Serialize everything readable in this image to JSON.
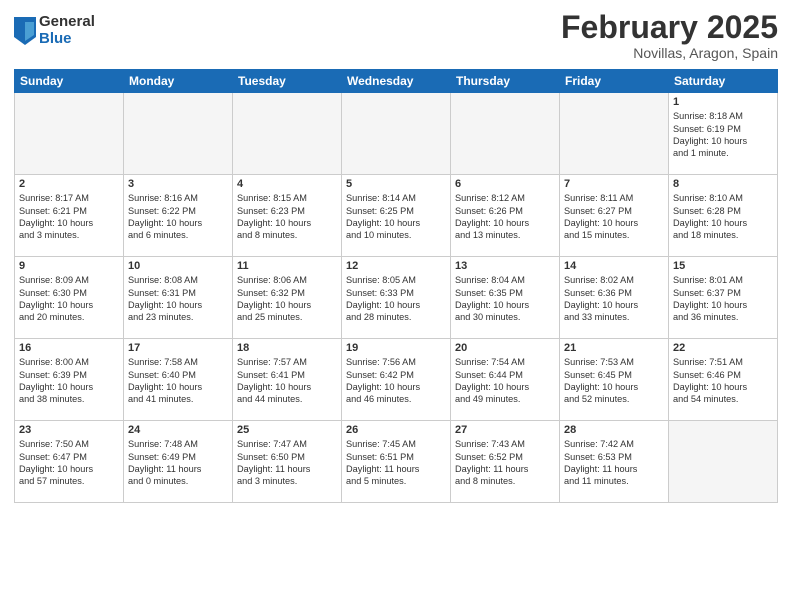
{
  "header": {
    "logo": {
      "general": "General",
      "blue": "Blue"
    },
    "title": "February 2025",
    "location": "Novillas, Aragon, Spain"
  },
  "weekdays": [
    "Sunday",
    "Monday",
    "Tuesday",
    "Wednesday",
    "Thursday",
    "Friday",
    "Saturday"
  ],
  "weeks": [
    [
      {
        "day": "",
        "info": ""
      },
      {
        "day": "",
        "info": ""
      },
      {
        "day": "",
        "info": ""
      },
      {
        "day": "",
        "info": ""
      },
      {
        "day": "",
        "info": ""
      },
      {
        "day": "",
        "info": ""
      },
      {
        "day": "1",
        "info": "Sunrise: 8:18 AM\nSunset: 6:19 PM\nDaylight: 10 hours\nand 1 minute."
      }
    ],
    [
      {
        "day": "2",
        "info": "Sunrise: 8:17 AM\nSunset: 6:21 PM\nDaylight: 10 hours\nand 3 minutes."
      },
      {
        "day": "3",
        "info": "Sunrise: 8:16 AM\nSunset: 6:22 PM\nDaylight: 10 hours\nand 6 minutes."
      },
      {
        "day": "4",
        "info": "Sunrise: 8:15 AM\nSunset: 6:23 PM\nDaylight: 10 hours\nand 8 minutes."
      },
      {
        "day": "5",
        "info": "Sunrise: 8:14 AM\nSunset: 6:25 PM\nDaylight: 10 hours\nand 10 minutes."
      },
      {
        "day": "6",
        "info": "Sunrise: 8:12 AM\nSunset: 6:26 PM\nDaylight: 10 hours\nand 13 minutes."
      },
      {
        "day": "7",
        "info": "Sunrise: 8:11 AM\nSunset: 6:27 PM\nDaylight: 10 hours\nand 15 minutes."
      },
      {
        "day": "8",
        "info": "Sunrise: 8:10 AM\nSunset: 6:28 PM\nDaylight: 10 hours\nand 18 minutes."
      }
    ],
    [
      {
        "day": "9",
        "info": "Sunrise: 8:09 AM\nSunset: 6:30 PM\nDaylight: 10 hours\nand 20 minutes."
      },
      {
        "day": "10",
        "info": "Sunrise: 8:08 AM\nSunset: 6:31 PM\nDaylight: 10 hours\nand 23 minutes."
      },
      {
        "day": "11",
        "info": "Sunrise: 8:06 AM\nSunset: 6:32 PM\nDaylight: 10 hours\nand 25 minutes."
      },
      {
        "day": "12",
        "info": "Sunrise: 8:05 AM\nSunset: 6:33 PM\nDaylight: 10 hours\nand 28 minutes."
      },
      {
        "day": "13",
        "info": "Sunrise: 8:04 AM\nSunset: 6:35 PM\nDaylight: 10 hours\nand 30 minutes."
      },
      {
        "day": "14",
        "info": "Sunrise: 8:02 AM\nSunset: 6:36 PM\nDaylight: 10 hours\nand 33 minutes."
      },
      {
        "day": "15",
        "info": "Sunrise: 8:01 AM\nSunset: 6:37 PM\nDaylight: 10 hours\nand 36 minutes."
      }
    ],
    [
      {
        "day": "16",
        "info": "Sunrise: 8:00 AM\nSunset: 6:39 PM\nDaylight: 10 hours\nand 38 minutes."
      },
      {
        "day": "17",
        "info": "Sunrise: 7:58 AM\nSunset: 6:40 PM\nDaylight: 10 hours\nand 41 minutes."
      },
      {
        "day": "18",
        "info": "Sunrise: 7:57 AM\nSunset: 6:41 PM\nDaylight: 10 hours\nand 44 minutes."
      },
      {
        "day": "19",
        "info": "Sunrise: 7:56 AM\nSunset: 6:42 PM\nDaylight: 10 hours\nand 46 minutes."
      },
      {
        "day": "20",
        "info": "Sunrise: 7:54 AM\nSunset: 6:44 PM\nDaylight: 10 hours\nand 49 minutes."
      },
      {
        "day": "21",
        "info": "Sunrise: 7:53 AM\nSunset: 6:45 PM\nDaylight: 10 hours\nand 52 minutes."
      },
      {
        "day": "22",
        "info": "Sunrise: 7:51 AM\nSunset: 6:46 PM\nDaylight: 10 hours\nand 54 minutes."
      }
    ],
    [
      {
        "day": "23",
        "info": "Sunrise: 7:50 AM\nSunset: 6:47 PM\nDaylight: 10 hours\nand 57 minutes."
      },
      {
        "day": "24",
        "info": "Sunrise: 7:48 AM\nSunset: 6:49 PM\nDaylight: 11 hours\nand 0 minutes."
      },
      {
        "day": "25",
        "info": "Sunrise: 7:47 AM\nSunset: 6:50 PM\nDaylight: 11 hours\nand 3 minutes."
      },
      {
        "day": "26",
        "info": "Sunrise: 7:45 AM\nSunset: 6:51 PM\nDaylight: 11 hours\nand 5 minutes."
      },
      {
        "day": "27",
        "info": "Sunrise: 7:43 AM\nSunset: 6:52 PM\nDaylight: 11 hours\nand 8 minutes."
      },
      {
        "day": "28",
        "info": "Sunrise: 7:42 AM\nSunset: 6:53 PM\nDaylight: 11 hours\nand 11 minutes."
      },
      {
        "day": "",
        "info": ""
      }
    ]
  ]
}
